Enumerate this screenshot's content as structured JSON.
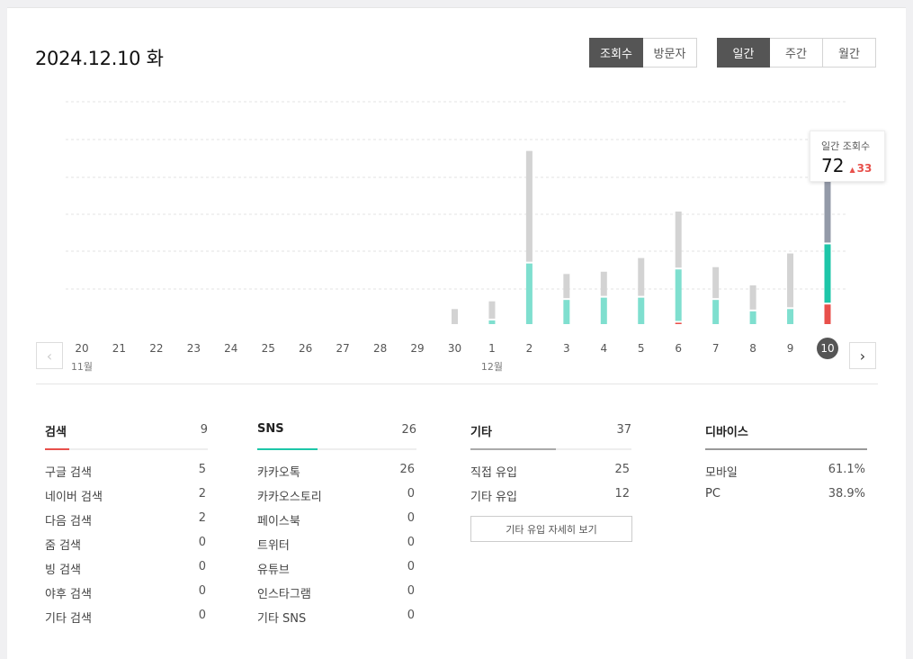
{
  "header": {
    "date": "2024.12.10 화"
  },
  "metric_toggle": [
    {
      "label": "조회수",
      "active": true
    },
    {
      "label": "방문자",
      "active": false
    }
  ],
  "period_toggle": [
    {
      "label": "일간",
      "active": true
    },
    {
      "label": "주간",
      "active": false
    },
    {
      "label": "월간",
      "active": false
    }
  ],
  "nav": {
    "prev_icon": "chevron-left-icon",
    "next_icon": "chevron-right-icon"
  },
  "tooltip": {
    "label": "일간 조회수",
    "value": "72",
    "diff": "33"
  },
  "colors": {
    "search": "#e8504b",
    "sns": "#1dc6a8",
    "etc": "#aaaaaa",
    "selected": "#939aa8",
    "sns_bar": "#7fdfcf",
    "etc_bar": "#d3d3d3"
  },
  "chart_data": {
    "type": "bar",
    "stacked": true,
    "categories": [
      "20",
      "21",
      "22",
      "23",
      "24",
      "25",
      "26",
      "27",
      "28",
      "29",
      "30",
      "1",
      "2",
      "3",
      "4",
      "5",
      "6",
      "7",
      "8",
      "9",
      "10"
    ],
    "month_labels": [
      {
        "at": "20",
        "label": "11월"
      },
      {
        "at": "1",
        "label": "12월"
      }
    ],
    "selected": "10",
    "series": [
      {
        "key": "search",
        "values": [
          0,
          0,
          0,
          0,
          0,
          0,
          0,
          0,
          0,
          0,
          0,
          0,
          0,
          0,
          0,
          0,
          1,
          0,
          0,
          0,
          9
        ]
      },
      {
        "key": "sns",
        "values": [
          0,
          0,
          0,
          0,
          0,
          0,
          0,
          0,
          0,
          0,
          0,
          2,
          27,
          11,
          12,
          12,
          23,
          11,
          6,
          7,
          26
        ]
      },
      {
        "key": "etc",
        "values": [
          0,
          0,
          0,
          0,
          0,
          0,
          0,
          0,
          0,
          0,
          7,
          8,
          49,
          11,
          11,
          17,
          25,
          14,
          11,
          24,
          37
        ]
      }
    ],
    "ylim": [
      0,
      98
    ],
    "grid": true
  },
  "stats": {
    "search": {
      "title": "검색",
      "total": "9",
      "fill": 0.15,
      "rows": [
        {
          "label": "구글 검색",
          "value": "5"
        },
        {
          "label": "네이버 검색",
          "value": "2"
        },
        {
          "label": "다음 검색",
          "value": "2"
        },
        {
          "label": "줌 검색",
          "value": "0"
        },
        {
          "label": "빙 검색",
          "value": "0"
        },
        {
          "label": "야후 검색",
          "value": "0"
        },
        {
          "label": "기타 검색",
          "value": "0"
        }
      ]
    },
    "sns": {
      "title": "SNS",
      "total": "26",
      "fill": 0.38,
      "rows": [
        {
          "label": "카카오톡",
          "value": "26"
        },
        {
          "label": "카카오스토리",
          "value": "0"
        },
        {
          "label": "페이스북",
          "value": "0"
        },
        {
          "label": "트위터",
          "value": "0"
        },
        {
          "label": "유튜브",
          "value": "0"
        },
        {
          "label": "인스타그램",
          "value": "0"
        },
        {
          "label": "기타 SNS",
          "value": "0"
        }
      ]
    },
    "etc": {
      "title": "기타",
      "total": "37",
      "fill": 0.53,
      "rows": [
        {
          "label": "직접 유입",
          "value": "25"
        },
        {
          "label": "기타 유입",
          "value": "12"
        }
      ],
      "detail_button": "기타 유입 자세히 보기"
    },
    "device": {
      "title": "디바이스",
      "rows": [
        {
          "label": "모바일",
          "value": "61.1%"
        },
        {
          "label": "PC",
          "value": "38.9%"
        }
      ]
    }
  }
}
